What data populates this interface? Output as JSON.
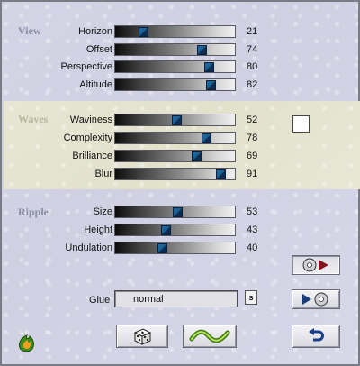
{
  "sections": {
    "view": "View",
    "waves": "Waves",
    "ripple": "Ripple"
  },
  "sliders": [
    {
      "label": "Horizon",
      "value": 21,
      "thumb_fraction": 0.23
    },
    {
      "label": "Offset",
      "value": 74,
      "thumb_fraction": 0.72
    },
    {
      "label": "Perspective",
      "value": 80,
      "thumb_fraction": 0.78
    },
    {
      "label": "Altitude",
      "value": 82,
      "thumb_fraction": 0.8
    },
    {
      "label": "Waviness",
      "value": 52,
      "thumb_fraction": 0.51
    },
    {
      "label": "Complexity",
      "value": 78,
      "thumb_fraction": 0.76
    },
    {
      "label": "Brilliance",
      "value": 69,
      "thumb_fraction": 0.68
    },
    {
      "label": "Blur",
      "value": 91,
      "thumb_fraction": 0.88
    },
    {
      "label": "Size",
      "value": 53,
      "thumb_fraction": 0.52
    },
    {
      "label": "Height",
      "value": 43,
      "thumb_fraction": 0.42
    },
    {
      "label": "Undulation",
      "value": 40,
      "thumb_fraction": 0.39
    }
  ],
  "glue": {
    "label": "Glue",
    "value": "normal",
    "s_label": "s"
  },
  "icons": {
    "logo": "flame-leaf-logo",
    "color_swatch": "white-swatch",
    "play_cd": "cd-play-icon",
    "cd_forward": "play-cd-icon",
    "dice": "dice-icon",
    "wave": "wave-icon",
    "undo": "undo-arrow-icon"
  },
  "colors": {
    "section_view": "#8a8ea4",
    "section_waves": "#b8b69c",
    "thumb": "#1a5d8f",
    "background": "#d3d4e4",
    "waves_band": "#e7e6d4"
  }
}
